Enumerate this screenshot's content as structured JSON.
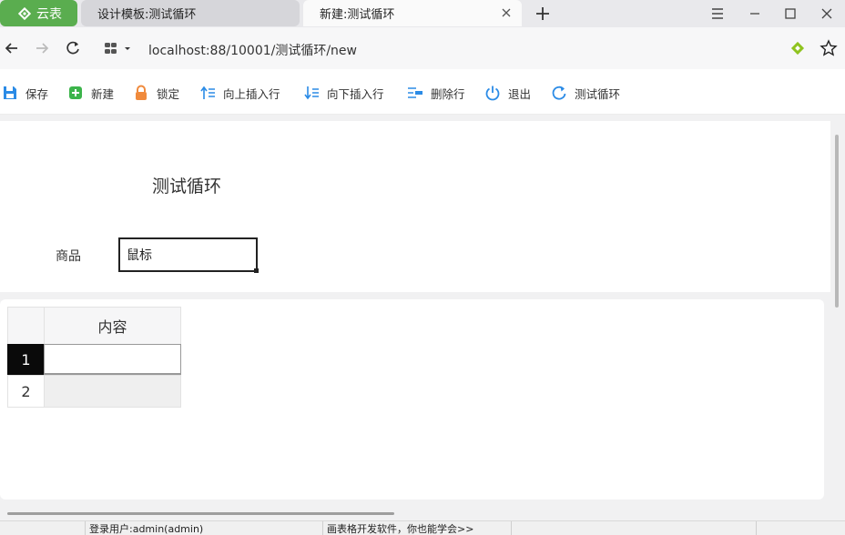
{
  "browser": {
    "brand_tab": "云表",
    "tabs": [
      {
        "label": "设计模板:测试循环"
      },
      {
        "label": "新建:测试循环"
      }
    ],
    "url": "localhost:88/10001/测试循环/new"
  },
  "toolbar": {
    "items": [
      {
        "label": "保存",
        "icon": "save-icon"
      },
      {
        "label": "新建",
        "icon": "new-icon"
      },
      {
        "label": "锁定",
        "icon": "lock-icon"
      },
      {
        "label": "向上插入行",
        "icon": "insert-row-above-icon"
      },
      {
        "label": "向下插入行",
        "icon": "insert-row-below-icon"
      },
      {
        "label": "删除行",
        "icon": "delete-row-icon"
      },
      {
        "label": "退出",
        "icon": "power-icon"
      },
      {
        "label": "测试循环",
        "icon": "refresh-icon"
      }
    ]
  },
  "form": {
    "title": "测试循环",
    "field_label": "商品",
    "field_value": "鼠标"
  },
  "grid": {
    "column_header": "内容",
    "rows": [
      "1",
      "2"
    ]
  },
  "status": {
    "user": "登录用户:admin(admin)",
    "slogan": "画表格开发软件，你也能学会>>"
  },
  "colors": {
    "brand_green": "#5aad4f",
    "icon_blue": "#2b8be6",
    "icon_green": "#3cb44b",
    "icon_orange": "#f08a3c"
  }
}
